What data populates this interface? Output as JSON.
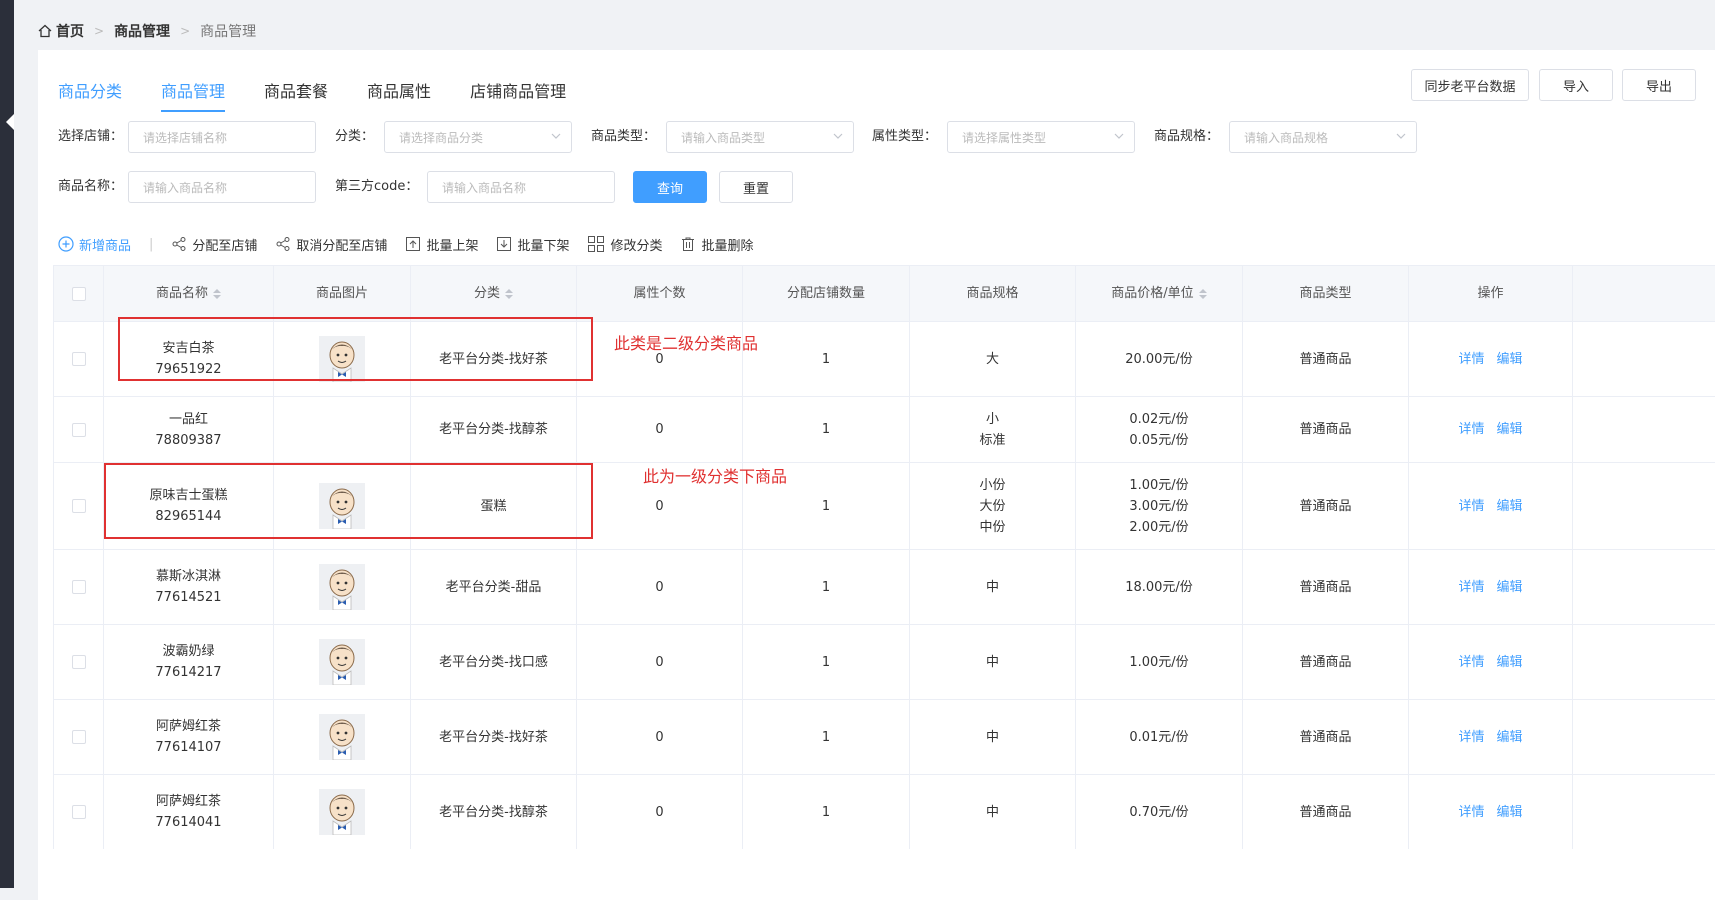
{
  "breadcrumb": {
    "items": [
      "首页",
      "商品管理",
      "商品管理"
    ]
  },
  "tabs": [
    "商品分类",
    "商品管理",
    "商品套餐",
    "商品属性",
    "店铺商品管理"
  ],
  "top_buttons": {
    "sync": "同步老平台数据",
    "import": "导入",
    "export": "导出"
  },
  "filters": {
    "store": {
      "label": "选择店铺：",
      "placeholder": "请选择店铺名称"
    },
    "category": {
      "label": "分类：",
      "placeholder": "请选择商品分类"
    },
    "product_type": {
      "label": "商品类型：",
      "placeholder": "请输入商品类型"
    },
    "attr_type": {
      "label": "属性类型：",
      "placeholder": "请选择属性类型"
    },
    "spec": {
      "label": "商品规格：",
      "placeholder": "请输入商品规格"
    },
    "name": {
      "label": "商品名称：",
      "placeholder": "请输入商品名称"
    },
    "code": {
      "label": "第三方code：",
      "placeholder": "请输入商品名称"
    },
    "query": "查询",
    "reset": "重置"
  },
  "actions": {
    "add": "新增商品",
    "assign": "分配至店铺",
    "unassign": "取消分配至店铺",
    "batch_up": "批量上架",
    "batch_down": "批量下架",
    "edit_category": "修改分类",
    "batch_delete": "批量删除"
  },
  "table": {
    "headers": [
      "商品名称",
      "商品图片",
      "分类",
      "属性个数",
      "分配店铺数量",
      "商品规格",
      "商品价格/单位",
      "商品类型",
      "操作"
    ],
    "detail_label": "详情",
    "edit_label": "编辑",
    "rows": [
      {
        "name": "安吉白茶",
        "code": "79651922",
        "has_image": true,
        "category": "老平台分类-找好茶",
        "attr_count": "0",
        "store_count": "1",
        "specs": [
          "大"
        ],
        "prices": [
          "20.00元/份"
        ],
        "type": "普通商品"
      },
      {
        "name": "一品红",
        "code": "78809387",
        "has_image": false,
        "category": "老平台分类-找醇茶",
        "attr_count": "0",
        "store_count": "1",
        "specs": [
          "小",
          "标准"
        ],
        "prices": [
          "0.02元/份",
          "0.05元/份"
        ],
        "type": "普通商品"
      },
      {
        "name": "原味吉士蛋糕",
        "code": "82965144",
        "has_image": true,
        "category": "蛋糕",
        "attr_count": "0",
        "store_count": "1",
        "specs": [
          "小份",
          "大份",
          "中份"
        ],
        "prices": [
          "1.00元/份",
          "3.00元/份",
          "2.00元/份"
        ],
        "type": "普通商品"
      },
      {
        "name": "慕斯冰淇淋",
        "code": "77614521",
        "has_image": true,
        "category": "老平台分类-甜品",
        "attr_count": "0",
        "store_count": "1",
        "specs": [
          "中"
        ],
        "prices": [
          "18.00元/份"
        ],
        "type": "普通商品"
      },
      {
        "name": "波霸奶绿",
        "code": "77614217",
        "has_image": true,
        "category": "老平台分类-找口感",
        "attr_count": "0",
        "store_count": "1",
        "specs": [
          "中"
        ],
        "prices": [
          "1.00元/份"
        ],
        "type": "普通商品"
      },
      {
        "name": "阿萨姆红茶",
        "code": "77614107",
        "has_image": true,
        "category": "老平台分类-找好茶",
        "attr_count": "0",
        "store_count": "1",
        "specs": [
          "中"
        ],
        "prices": [
          "0.01元/份"
        ],
        "type": "普通商品"
      },
      {
        "name": "阿萨姆红茶",
        "code": "77614041",
        "has_image": true,
        "category": "老平台分类-找醇茶",
        "attr_count": "0",
        "store_count": "1",
        "specs": [
          "中"
        ],
        "prices": [
          "0.70元/份"
        ],
        "type": "普通商品"
      }
    ]
  },
  "annotations": {
    "second_level": "此类是二级分类商品",
    "first_level": "此为一级分类下商品"
  },
  "colors": {
    "accent": "#409eff",
    "annotation": "#e03131"
  }
}
